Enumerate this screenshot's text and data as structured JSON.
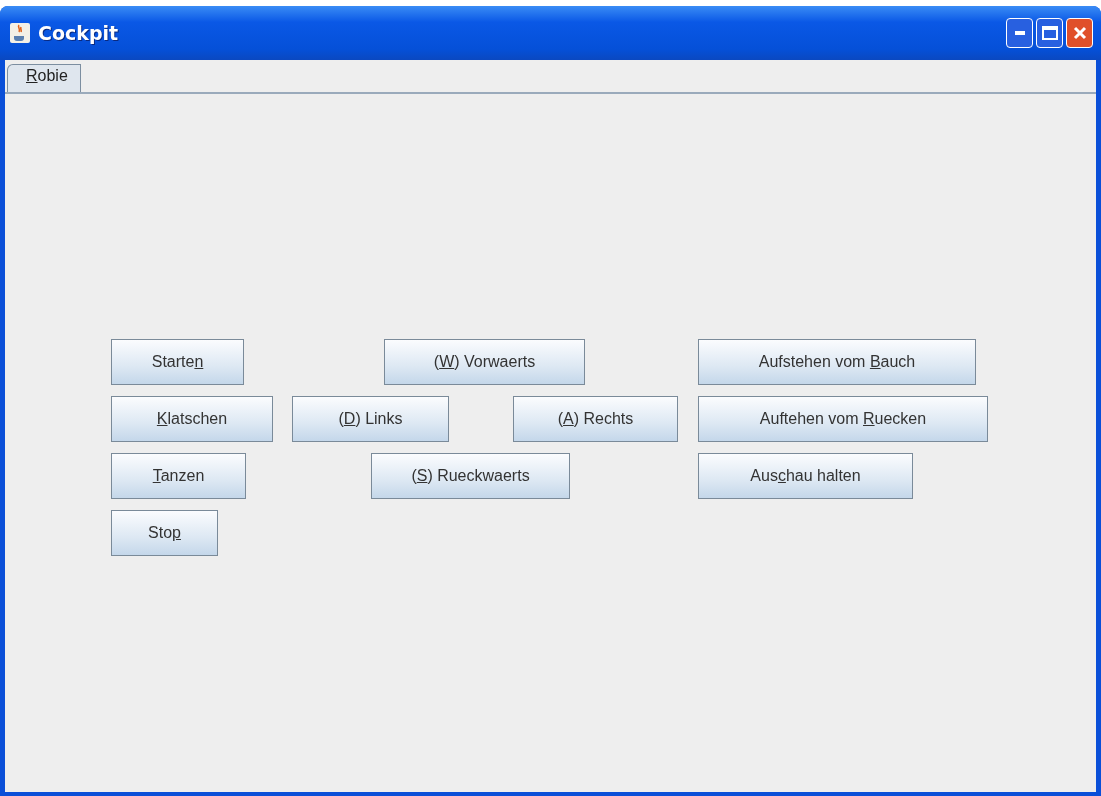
{
  "window": {
    "title": "Cockpit"
  },
  "tabs": [
    {
      "key": "R",
      "post": "obie",
      "selected": true
    }
  ],
  "button_rows": [
    [
      {
        "pre": "Starte",
        "key": "n"
      },
      {
        "pre": "(",
        "key": "W",
        "post": ") Vorwaerts"
      },
      {
        "pre": "Aufstehen vom ",
        "key": "B",
        "post": "auch"
      }
    ],
    [
      {
        "key": "K",
        "post": "latschen"
      },
      {
        "pre": "(",
        "key": "D",
        "post": ") Links"
      },
      {
        "pre": "(",
        "key": "A",
        "post": ") Rechts"
      },
      {
        "pre": "Auftehen vom ",
        "key": "R",
        "post": "uecken"
      }
    ],
    [
      {
        "key": "T",
        "post": "anzen"
      },
      {
        "pre": "(",
        "key": "S",
        "post": ") Rueckwaerts"
      },
      {
        "pre": "Aus",
        "key": "c",
        "post": "hau halten"
      }
    ],
    [
      {
        "pre": "Sto",
        "key": "p"
      }
    ]
  ]
}
